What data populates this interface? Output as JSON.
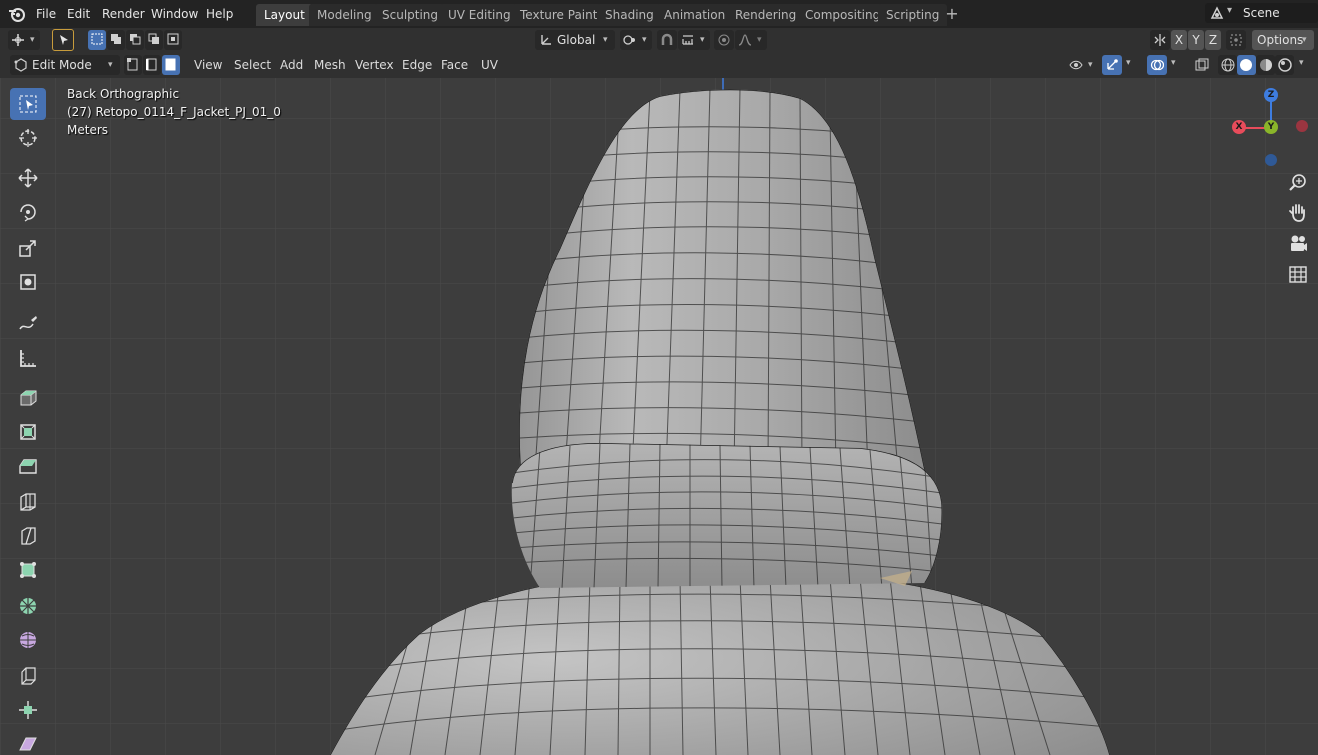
{
  "menu": {
    "items": [
      "File",
      "Edit",
      "Render",
      "Window",
      "Help"
    ]
  },
  "workspaces": {
    "tabs": [
      "Layout",
      "Modeling",
      "Sculpting",
      "UV Editing",
      "Texture Paint",
      "Shading",
      "Animation",
      "Rendering",
      "Compositing",
      "Scripting"
    ],
    "active": "Layout"
  },
  "scene": {
    "name": "Scene"
  },
  "tool_settings": {
    "orientation": "Global",
    "axis_x": "X",
    "axis_y": "Y",
    "axis_z": "Z",
    "options_label": "Options"
  },
  "view_header": {
    "mode": "Edit Mode",
    "menus": [
      "View",
      "Select",
      "Add",
      "Mesh",
      "Vertex",
      "Edge",
      "Face",
      "UV"
    ]
  },
  "viewport": {
    "view_name": "Back Orthographic",
    "object_name": "(27) Retopo_0114_F_Jacket_PJ_01_0",
    "units": "Meters"
  },
  "gizmo": {
    "x_label": "X",
    "y_label": "Y",
    "z_label": "Z"
  },
  "colors": {
    "accent": "#4772b3",
    "axis_x": "#e84c5b",
    "axis_y": "#8ab52a",
    "axis_z": "#3e7de0",
    "mesh": "#9a9a9a"
  },
  "toolbar_icons": [
    "select-box-icon",
    "cursor-icon",
    "move-icon",
    "rotate-icon",
    "scale-icon",
    "transform-icon",
    "annotate-icon",
    "measure-icon",
    "add-cube-icon",
    "extrude-icon",
    "inset-icon",
    "bevel-icon",
    "loop-cut-icon",
    "knife-icon",
    "poly-build-icon",
    "spin-icon",
    "smooth-icon",
    "edge-slide-icon",
    "shrink-fatten-icon",
    "shear-icon"
  ]
}
